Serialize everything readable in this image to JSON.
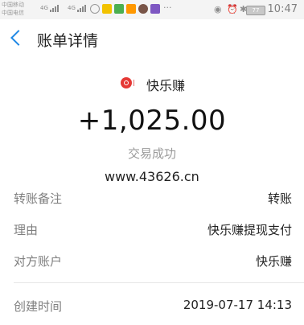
{
  "status_bar": {
    "carrier_1": "中国移动",
    "carrier_2": "中国电信",
    "sig1_label": "4G",
    "sig2_label": "4G",
    "battery": "77",
    "time": "10:47"
  },
  "header": {
    "back_icon": "chevron-left-icon",
    "title": "账单详情"
  },
  "merchant": {
    "logo_icon": "merchant-logo-icon",
    "name": "快乐赚"
  },
  "summary": {
    "amount": "+1,025.00",
    "status": "交易成功"
  },
  "watermark": "www.43626.cn",
  "details": [
    {
      "label": "转账备注",
      "value": "转账"
    },
    {
      "label": "理由",
      "value": "快乐赚提现支付"
    },
    {
      "label": "对方账户",
      "value": "快乐赚"
    }
  ],
  "created": {
    "label": "创建时间",
    "value": "2019-07-17 14:13"
  },
  "colors": {
    "accent": "#1e88e5",
    "logo": "#e53935"
  }
}
